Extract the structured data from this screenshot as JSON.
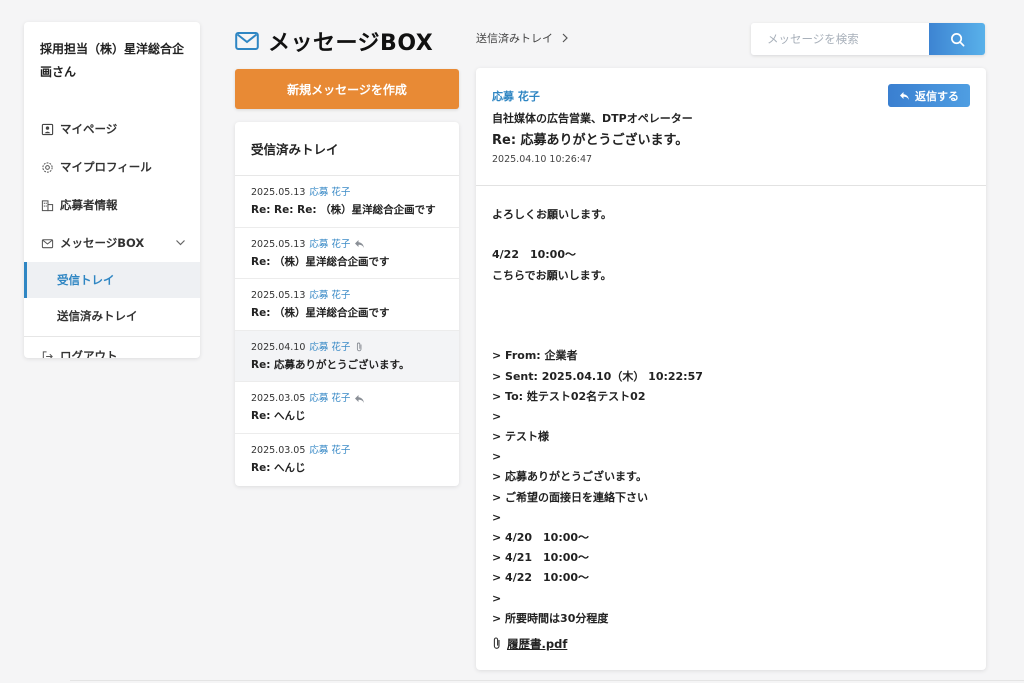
{
  "sidebar": {
    "user_name": "採用担当（株）星洋総合企画さん",
    "items": [
      {
        "label": "マイページ",
        "icon": "person-card-icon"
      },
      {
        "label": "マイプロフィール",
        "icon": "gear-icon"
      },
      {
        "label": "応募者情報",
        "icon": "building-icon"
      },
      {
        "label": "メッセージBOX",
        "icon": "mail-icon"
      }
    ],
    "sub_items": [
      {
        "label": "受信トレイ",
        "active": true
      },
      {
        "label": "送信済みトレイ",
        "active": false
      }
    ],
    "logout_label": "ログアウト"
  },
  "header": {
    "title": "メッセージBOX",
    "breadcrumb": "送信済みトレイ",
    "search_placeholder": "メッセージを検索"
  },
  "compose_label": "新規メッセージを作成",
  "inbox": {
    "title": "受信済みトレイ",
    "messages": [
      {
        "date": "2025.05.13",
        "sender": "応募 花子",
        "indicator": "",
        "subject": "Re: Re: Re: （株）星洋総合企画です"
      },
      {
        "date": "2025.05.13",
        "sender": "応募 花子",
        "indicator": "reply-icon",
        "subject": "Re: （株）星洋総合企画です"
      },
      {
        "date": "2025.05.13",
        "sender": "応募 花子",
        "indicator": "",
        "subject": "Re: （株）星洋総合企画です"
      },
      {
        "date": "2025.04.10",
        "sender": "応募 花子",
        "indicator": "paperclip-icon",
        "subject": "Re: 応募ありがとうございます。"
      },
      {
        "date": "2025.03.05",
        "sender": "応募 花子",
        "indicator": "reply-icon",
        "subject": "Re: へんじ"
      },
      {
        "date": "2025.03.05",
        "sender": "応募 花子",
        "indicator": "",
        "subject": "Re: へんじ"
      }
    ]
  },
  "detail": {
    "sender": "応募 花子",
    "job": "自社媒体の広告営業、DTPオペレーター",
    "subject": "Re: 応募ありがとうございます。",
    "date": "2025.04.10 10:26:47",
    "reply_label": "返信する",
    "body": [
      "よろしくお願いします。",
      "",
      "4/22　10:00〜",
      "こちらでお願いします。",
      "",
      "",
      "",
      "> From: 企業者",
      "> Sent: 2025.04.10（木） 10:22:57",
      "> To: 姓テスト02名テスト02",
      ">",
      "> テスト様",
      ">",
      "> 応募ありがとうございます。",
      "> ご希望の面接日を連絡下さい",
      ">",
      "> 4/20　10:00〜",
      "> 4/21　10:00〜",
      "> 4/22　10:00〜",
      ">",
      "> 所要時間は30分程度"
    ],
    "attachment": "履歴書.pdf"
  },
  "colors": {
    "accent_blue": "#2f86c3",
    "compose_orange": "#e88a35",
    "search_button": "#3d84d2"
  }
}
